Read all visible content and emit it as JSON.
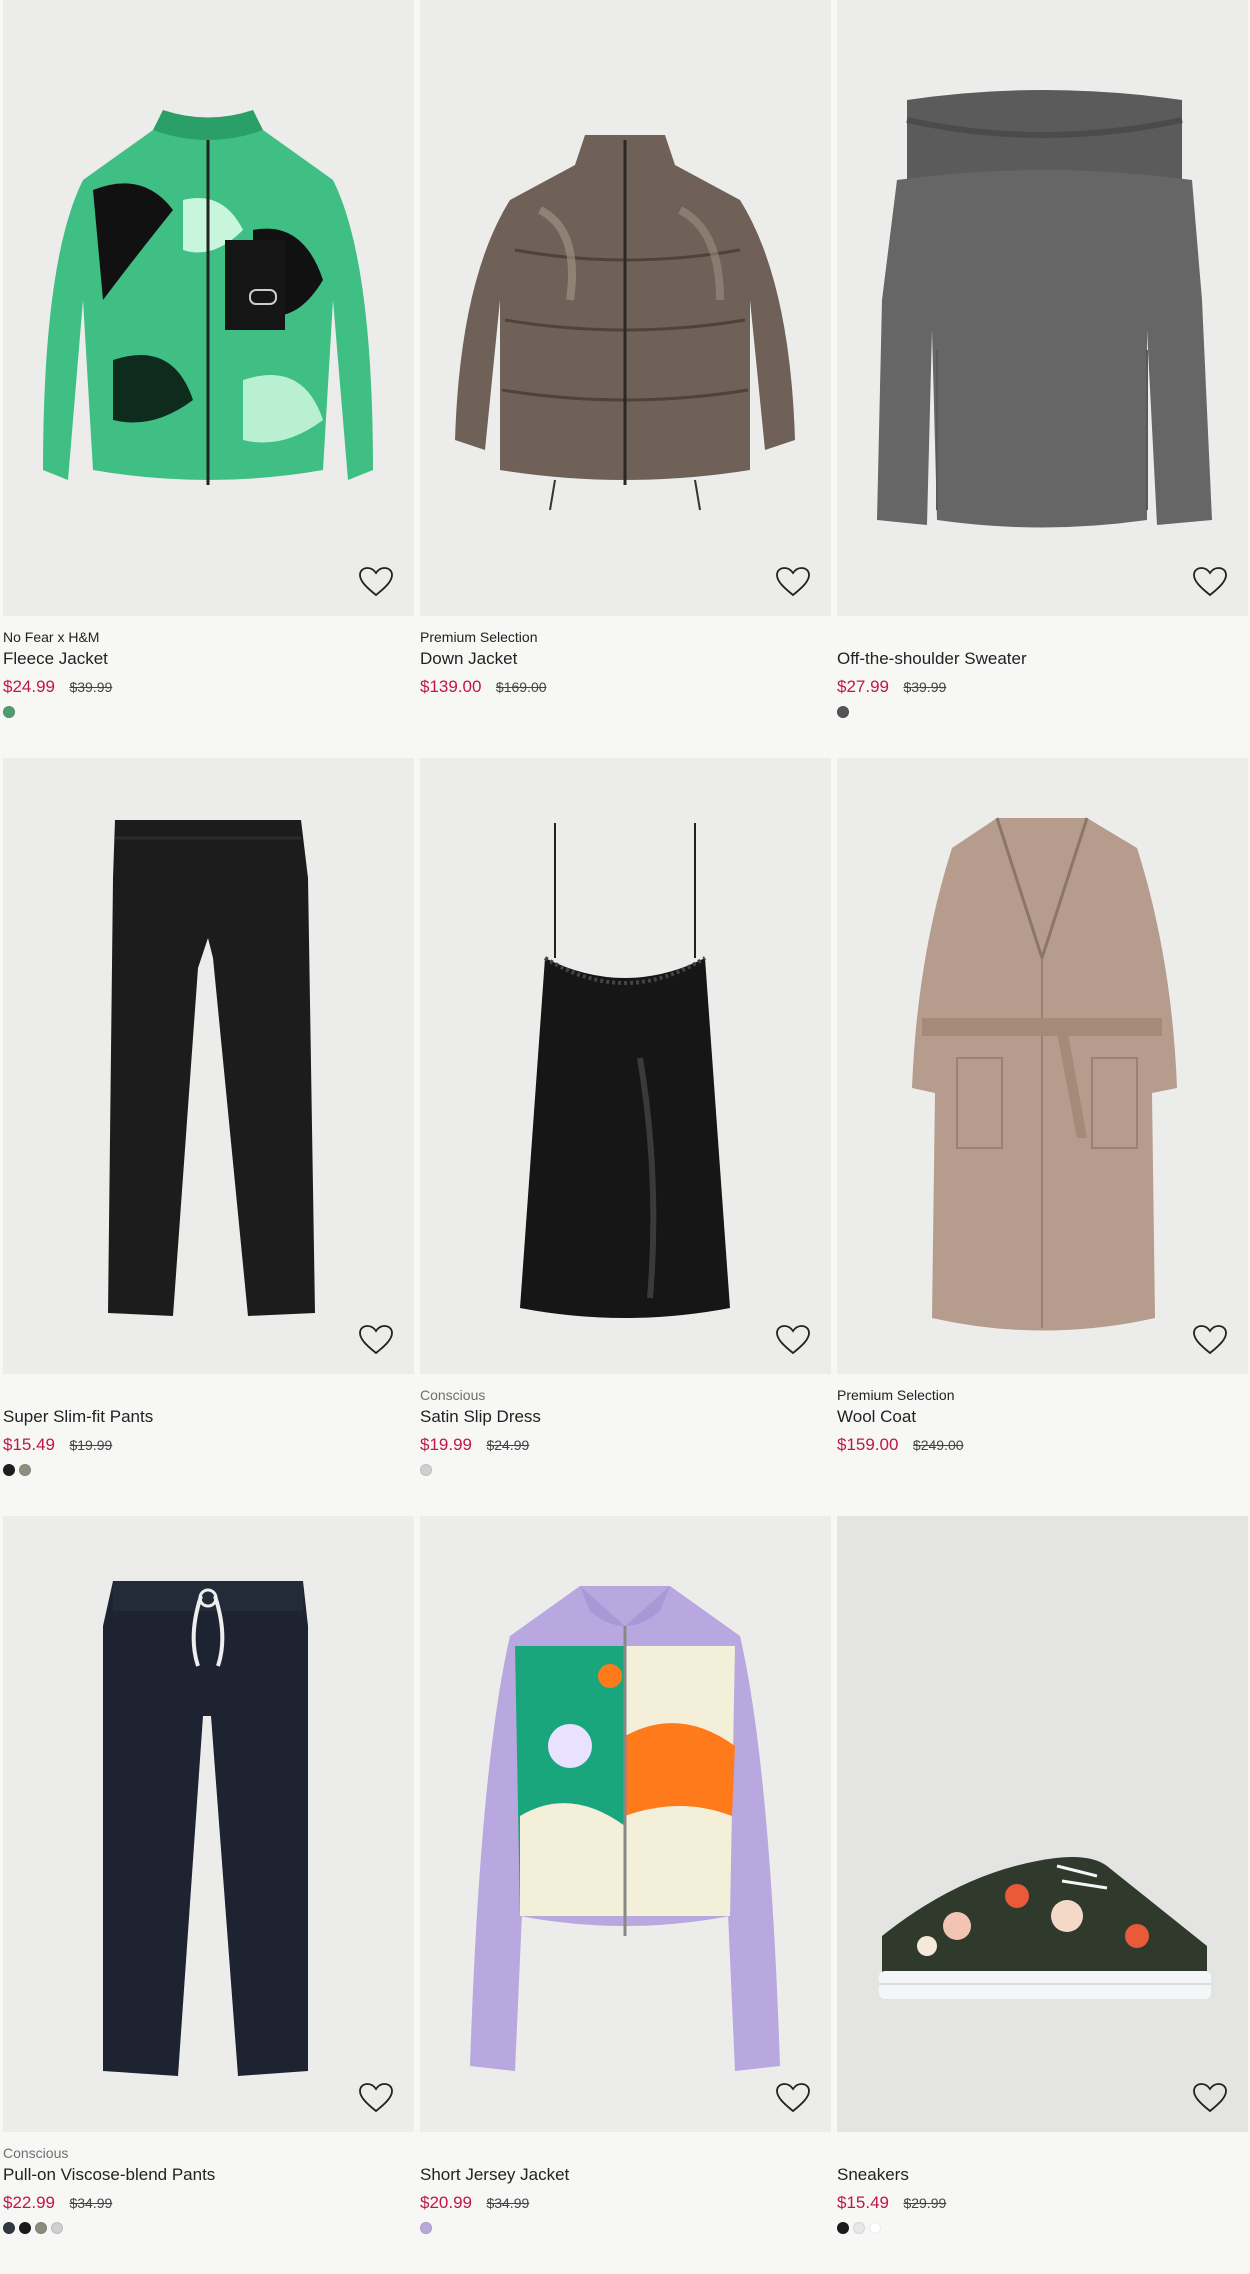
{
  "products": [
    {
      "label": "No Fear x H&M",
      "label_style": "normal",
      "title": "Fleece Jacket",
      "sale_price": "$24.99",
      "original_price": "$39.99",
      "swatches": [
        "#4f9d6f"
      ],
      "icon": "fleece-jacket-image"
    },
    {
      "label": "Premium Selection",
      "label_style": "normal",
      "title": "Down Jacket",
      "sale_price": "$139.00",
      "original_price": "$169.00",
      "swatches": [],
      "icon": "down-jacket-image"
    },
    {
      "label": "",
      "label_style": "normal",
      "title": "Off-the-shoulder Sweater",
      "sale_price": "$27.99",
      "original_price": "$39.99",
      "swatches": [
        "#555555"
      ],
      "icon": "sweater-image"
    },
    {
      "label": "",
      "label_style": "normal",
      "title": "Super Slim-fit Pants",
      "sale_price": "$15.49",
      "original_price": "$19.99",
      "swatches": [
        "#1e1e1e",
        "#8f8f7e"
      ],
      "icon": "pants-image"
    },
    {
      "label": "Conscious",
      "label_style": "conscious",
      "title": "Satin Slip Dress",
      "sale_price": "$19.99",
      "original_price": "$24.99",
      "swatches": [
        "#cfcfcf"
      ],
      "icon": "slip-dress-image"
    },
    {
      "label": "Premium Selection",
      "label_style": "normal",
      "title": "Wool Coat",
      "sale_price": "$159.00",
      "original_price": "$249.00",
      "swatches": [],
      "icon": "wool-coat-image"
    },
    {
      "label": "Conscious",
      "label_style": "conscious",
      "title": "Pull-on Viscose-blend Pants",
      "sale_price": "$22.99",
      "original_price": "$34.99",
      "swatches": [
        "#333840",
        "#1b1b1b",
        "#8d8b7c",
        "#cfcfcf"
      ],
      "icon": "viscose-pants-image"
    },
    {
      "label": "",
      "label_style": "normal",
      "title": "Short Jersey Jacket",
      "sale_price": "$20.99",
      "original_price": "$34.99",
      "swatches": [
        "#b8a9dd"
      ],
      "icon": "jersey-jacket-image"
    },
    {
      "label": "",
      "label_style": "normal",
      "title": "Sneakers",
      "sale_price": "$15.49",
      "original_price": "$29.99",
      "swatches": [
        "#1b1b1b",
        "#e8e8e8",
        "#ffffff"
      ],
      "icon": "sneakers-image"
    }
  ],
  "colors": {
    "sale": "#c1154b",
    "background": "#f7f7f6",
    "photo_bg": "#ebebea"
  }
}
